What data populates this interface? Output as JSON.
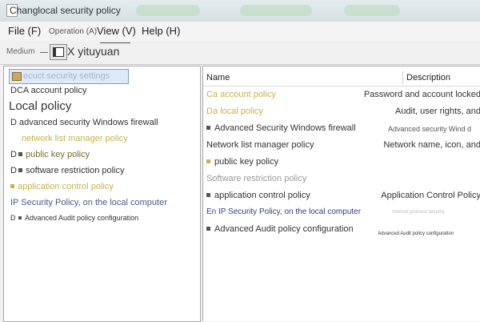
{
  "window": {
    "title": "Changlocal security policy"
  },
  "menubar": {
    "file": "File (F)",
    "operation": "Operation (A)",
    "view": "View (V)",
    "help": "Help (H)"
  },
  "toolbar": {
    "medium": "Medium",
    "label": "X yituyuan"
  },
  "tree": {
    "root": "ecuct security settings",
    "items": [
      "DCA account policy",
      "Local policy",
      "D advanced security Windows firewall",
      "network list manager policy",
      "public key policy",
      "software restriction policy",
      "application control policy",
      "IP Security Policy, on the local computer",
      "Advanced Audit policy configuration"
    ],
    "prefixes": [
      "D",
      "D",
      "D"
    ]
  },
  "list": {
    "headers": {
      "name": "Name",
      "description": "Description"
    },
    "rows": [
      {
        "name": "Ca account policy",
        "description": "Password and account locked"
      },
      {
        "name": "Da local policy",
        "description": "Audit, user rights, and"
      },
      {
        "name": "Advanced Security Windows firewall",
        "description": "Advanced security Wind d"
      },
      {
        "name": "Network list manager policy",
        "description": "Network name, icon, and"
      },
      {
        "name": "public key policy",
        "description": ""
      },
      {
        "name": "Software restriction policy",
        "description": ""
      },
      {
        "name": "application control policy",
        "description": "Application Control Policy"
      },
      {
        "name": "En IP Security Policy, on the local computer",
        "description": "Internet protocol security"
      },
      {
        "name": "Advanced Audit policy configuration",
        "description": "Advanced Audit policy configuration"
      }
    ]
  }
}
